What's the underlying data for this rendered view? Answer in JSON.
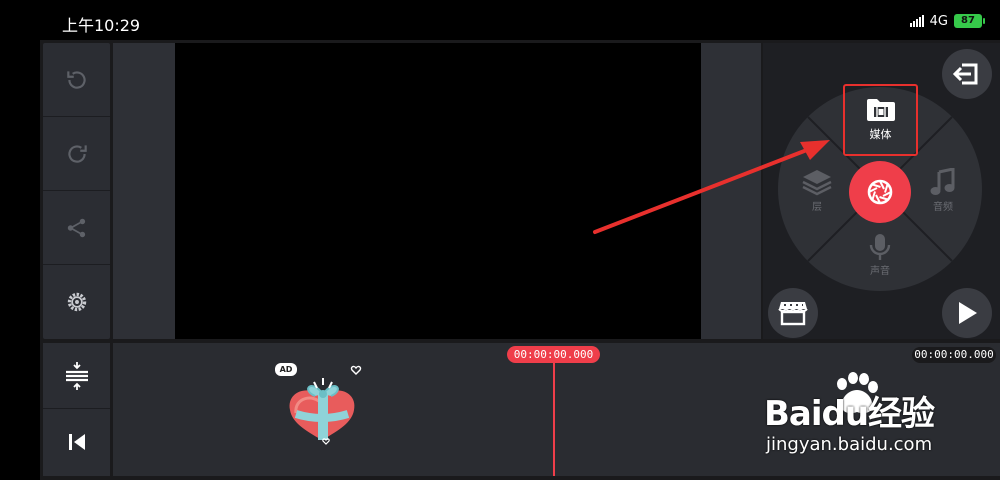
{
  "status_bar": {
    "time": "上午10:29",
    "network": "4G",
    "battery": "87"
  },
  "wheel": {
    "media_label": "媒体",
    "layer_label": "层",
    "audio_label": "音频",
    "voice_label": "声音"
  },
  "timeline": {
    "current_time": "00:00:00.000",
    "total_time": "00:00:00.000",
    "ad_badge": "AD"
  },
  "watermark": {
    "brand": "Baidu经验",
    "url": "jingyan.baidu.com"
  },
  "colors": {
    "accent": "#ef3e4a",
    "annotation": "#e8302d",
    "panel": "#2b2d33"
  },
  "icons": [
    "undo-icon",
    "redo-icon",
    "share-icon",
    "settings-icon",
    "exit-icon",
    "store-icon",
    "play-icon",
    "media-folder-icon",
    "layers-icon",
    "music-note-icon",
    "microphone-icon",
    "camera-shutter-icon",
    "zoom-timeline-icon",
    "skip-to-start-icon"
  ]
}
